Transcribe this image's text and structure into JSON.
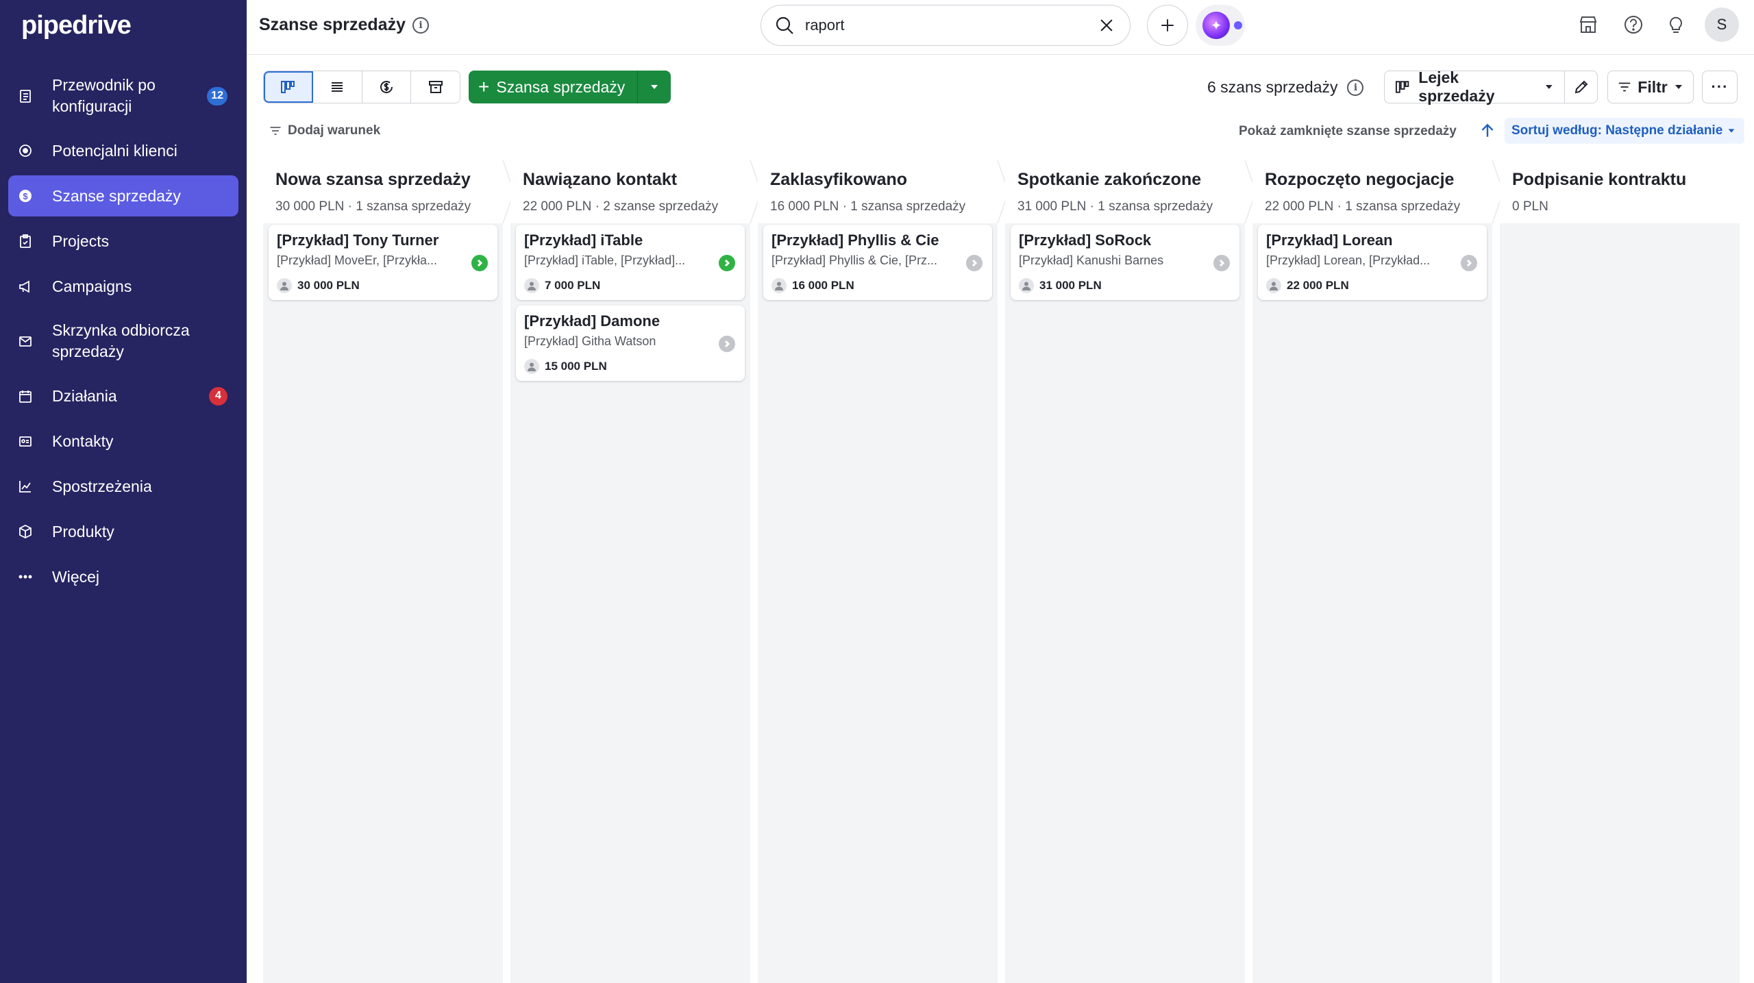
{
  "app": {
    "logo": "pipedrive"
  },
  "sidebar": {
    "items": [
      {
        "label": "Przewodnik po konfiguracji",
        "icon": "checklist-icon",
        "badge": "12",
        "badge_color": "#2e6fd6",
        "active": false
      },
      {
        "label": "Potencjalni klienci",
        "icon": "target-icon",
        "active": false
      },
      {
        "label": "Szanse sprzedaży",
        "icon": "dollar-circle-icon",
        "active": true
      },
      {
        "label": "Projects",
        "icon": "clipboard-icon",
        "active": false
      },
      {
        "label": "Campaigns",
        "icon": "megaphone-icon",
        "active": false
      },
      {
        "label": "Skrzynka odbiorcza sprzedaży",
        "icon": "mail-icon",
        "active": false
      },
      {
        "label": "Działania",
        "icon": "calendar-icon",
        "badge": "4",
        "badge_color": "#d6303a",
        "active": false
      },
      {
        "label": "Kontakty",
        "icon": "contact-card-icon",
        "active": false
      },
      {
        "label": "Spostrzeżenia",
        "icon": "trend-chart-icon",
        "active": false
      },
      {
        "label": "Produkty",
        "icon": "box-icon",
        "active": false
      },
      {
        "label": "Więcej",
        "icon": "more-dots-icon",
        "active": false
      }
    ]
  },
  "header": {
    "title": "Szanse sprzedaży",
    "search_value": "raport"
  },
  "toolbar": {
    "add_deal_label": "Szansa sprzedaży",
    "deal_count": "6 szans sprzedaży",
    "pipeline_label": "Lejek sprzedaży",
    "filter_label": "Filtr",
    "more_label": "···",
    "add_condition": "Dodaj warunek",
    "show_closed": "Pokaż zamknięte szanse sprzedaży",
    "sort_label": "Sortuj według: Następne działanie"
  },
  "colors": {
    "sidebar_bg": "#262461",
    "sidebar_active": "#5b5ce2",
    "primary_green": "#1a8a3f",
    "link_blue": "#1f5fbf",
    "status_green": "#2fb344",
    "status_grey": "#c3c5cb"
  },
  "stages": [
    {
      "title": "Nowa szansa sprzedaży",
      "summary": "30 000 PLN · 1 szansa sprzedaży",
      "deals": [
        {
          "title": "[Przykład] Tony Turner",
          "subtitle": "[Przykład] MoveEr, [Przykła...",
          "value": "30 000 PLN",
          "status": "green"
        }
      ]
    },
    {
      "title": "Nawiązano kontakt",
      "summary": "22 000 PLN · 2 szanse sprzedaży",
      "deals": [
        {
          "title": "[Przykład] iTable",
          "subtitle": "[Przykład] iTable, [Przykład]...",
          "value": "7 000 PLN",
          "status": "green"
        },
        {
          "title": "[Przykład] Damone",
          "subtitle": "[Przykład] Githa Watson",
          "value": "15 000 PLN",
          "status": "grey"
        }
      ]
    },
    {
      "title": "Zaklasyfikowano",
      "summary": "16 000 PLN · 1 szansa sprzedaży",
      "deals": [
        {
          "title": "[Przykład] Phyllis & Cie",
          "subtitle": "[Przykład] Phyllis & Cie, [Prz...",
          "value": "16 000 PLN",
          "status": "grey"
        }
      ]
    },
    {
      "title": "Spotkanie zakończone",
      "summary": "31 000 PLN · 1 szansa sprzedaży",
      "deals": [
        {
          "title": "[Przykład] SoRock",
          "subtitle": "[Przykład] Kanushi Barnes",
          "value": "31 000 PLN",
          "status": "grey"
        }
      ]
    },
    {
      "title": "Rozpoczęto negocjacje",
      "summary": "22 000 PLN · 1 szansa sprzedaży",
      "deals": [
        {
          "title": "[Przykład] Lorean",
          "subtitle": "[Przykład] Lorean, [Przykład...",
          "value": "22 000 PLN",
          "status": "grey"
        }
      ]
    },
    {
      "title": "Podpisanie kontraktu",
      "summary": "0 PLN",
      "deals": []
    }
  ]
}
